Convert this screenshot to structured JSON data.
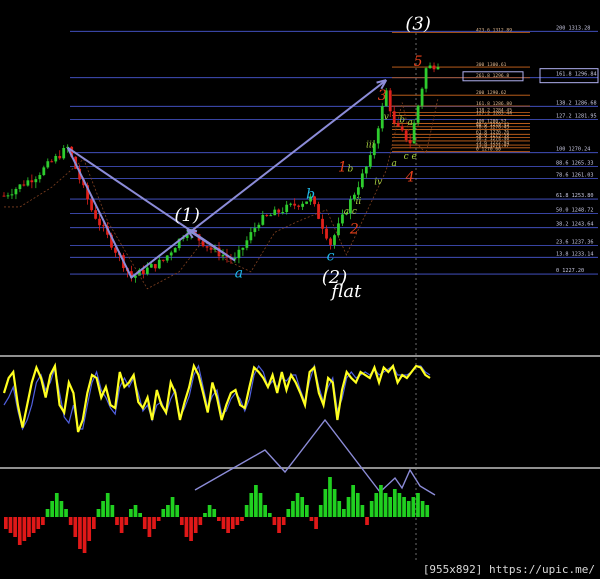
{
  "watermark": "[955x892] https://upic.me/",
  "colors": {
    "background": "#000000",
    "up_candle": "#2ecc2e",
    "down_candle": "#e0201a",
    "fib_line_blue": "#4a5ad8",
    "fib_line_orange": "#d2691e",
    "wave_arrow": "#8c8cd8",
    "wave_red": "#e8401a",
    "wave_cyan": "#20b8e8",
    "wave_white": "#ffffff",
    "wave_yellowgreen": "#a8d040",
    "oscillator_yellow": "#ffff20",
    "oscillator_blue": "#5060e0",
    "hist_green": "#20d020",
    "hist_red": "#e01818",
    "separator": "#909090"
  },
  "chart_data": {
    "type": "candlestick",
    "instrument": "",
    "ylim": [
      1218,
      1318
    ],
    "x_bars": 110,
    "fib_levels_blue": [
      {
        "label": "200 1313.28",
        "value": 1313.28
      },
      {
        "label": "161.8 1296.84",
        "value": 1296.84
      },
      {
        "label": "138.2 1286.68",
        "value": 1286.68
      },
      {
        "label": "127.2 1281.95",
        "value": 1281.95
      },
      {
        "label": "100 1270.24",
        "value": 1270.24
      },
      {
        "label": "88.6 1265.33",
        "value": 1265.33
      },
      {
        "label": "78.6 1261.03",
        "value": 1261.03
      },
      {
        "label": "61.8 1253.80",
        "value": 1253.8
      },
      {
        "label": "50.0 1248.72",
        "value": 1248.72
      },
      {
        "label": "38.2 1243.64",
        "value": 1243.64
      },
      {
        "label": "23.6 1237.36",
        "value": 1237.36
      },
      {
        "label": "13.8 1233.14",
        "value": 1233.14
      },
      {
        "label": "0 1227.20",
        "value": 1227.2
      }
    ],
    "fib_levels_orange": [
      {
        "label": "423.6 1312.89",
        "value": 1312.89
      },
      {
        "label": "300 1300.61",
        "value": 1300.61
      },
      {
        "label": "261.8 1296.8",
        "value": 1296.8
      },
      {
        "label": "200 1290.62",
        "value": 1290.62
      },
      {
        "label": "161.8 1286.80",
        "value": 1286.8
      },
      {
        "label": "138.2 1284.45",
        "value": 1284.45
      },
      {
        "label": "127.2 1283.44",
        "value": 1283.44
      },
      {
        "label": "100 1280.57",
        "value": 1280.57
      },
      {
        "label": "88.6 1279.43",
        "value": 1279.43
      },
      {
        "label": "78.6 1278.43",
        "value": 1278.43
      },
      {
        "label": "61.8 1276.76",
        "value": 1276.76
      },
      {
        "label": "50.0 1275.58",
        "value": 1275.58
      },
      {
        "label": "38.2 1274.40",
        "value": 1274.4
      },
      {
        "label": "23.6 1272.94",
        "value": 1272.94
      },
      {
        "label": "13.8 1271.97",
        "value": 1271.97
      },
      {
        "label": "0 1270.60",
        "value": 1270.6
      }
    ],
    "wave_labels": [
      {
        "text": "(3)",
        "color": "wave_white",
        "bar": 104,
        "price": 1314
      },
      {
        "text": "5",
        "color": "wave_red",
        "bar": 104,
        "price": 1301
      },
      {
        "text": "3",
        "color": "wave_red",
        "bar": 95,
        "price": 1289
      },
      {
        "text": "v",
        "color": "wave_yellowgreen",
        "bar": 96,
        "price": 1282
      },
      {
        "text": "b",
        "color": "wave_yellowgreen",
        "bar": 100,
        "price": 1281
      },
      {
        "text": "a",
        "color": "wave_yellowgreen",
        "bar": 102,
        "price": 1280
      },
      {
        "text": "iii",
        "color": "wave_yellowgreen",
        "bar": 92,
        "price": 1272
      },
      {
        "text": "c",
        "color": "wave_yellowgreen",
        "bar": 101,
        "price": 1268
      },
      {
        "text": "e",
        "color": "wave_yellowgreen",
        "bar": 103,
        "price": 1268
      },
      {
        "text": "a",
        "color": "wave_yellowgreen",
        "bar": 98,
        "price": 1265.5
      },
      {
        "text": "1",
        "color": "wave_red",
        "bar": 85,
        "price": 1263.5
      },
      {
        "text": "b",
        "color": "wave_yellowgreen",
        "bar": 87,
        "price": 1263.5
      },
      {
        "text": "4",
        "color": "wave_red",
        "bar": 102,
        "price": 1260
      },
      {
        "text": "iv",
        "color": "wave_yellowgreen",
        "bar": 94,
        "price": 1259
      },
      {
        "text": "ii",
        "color": "wave_yellowgreen",
        "bar": 89,
        "price": 1252
      },
      {
        "text": "a",
        "color": "wave_yellowgreen",
        "bar": 86,
        "price": 1248.5
      },
      {
        "text": "c",
        "color": "wave_yellowgreen",
        "bar": 88,
        "price": 1248.5
      },
      {
        "text": "b",
        "color": "wave_cyan",
        "bar": 77,
        "price": 1254
      },
      {
        "text": "(1)",
        "color": "wave_white",
        "bar": 46,
        "price": 1246
      },
      {
        "text": "2",
        "color": "wave_red",
        "bar": 88,
        "price": 1241.5
      },
      {
        "text": "c",
        "color": "wave_cyan",
        "bar": 82,
        "price": 1232
      },
      {
        "text": "a",
        "color": "wave_cyan",
        "bar": 59,
        "price": 1226
      },
      {
        "text": "(2)",
        "color": "wave_white",
        "bar": 83,
        "price": 1224
      },
      {
        "text": "flat",
        "color": "wave_white",
        "bar": 86,
        "price": 1219
      }
    ],
    "wave_path": [
      {
        "bar": 16,
        "price": 1272
      },
      {
        "bar": 32,
        "price": 1226
      },
      {
        "bar": 96,
        "price": 1296
      }
    ],
    "wave_path_2": [
      {
        "bar": 16,
        "price": 1272
      },
      {
        "bar": 58,
        "price": 1232
      },
      {
        "bar": 46,
        "price": 1243
      }
    ],
    "oscillator": {
      "type": "line",
      "series": [
        {
          "values": [
            48,
            58,
            62,
            40,
            25,
            40,
            55,
            65,
            58,
            45,
            60,
            66,
            40,
            35,
            55,
            48,
            22,
            30,
            48,
            60,
            58,
            45,
            52,
            40,
            38,
            62,
            52,
            55,
            60,
            42,
            38,
            45,
            30,
            50,
            40,
            35,
            55,
            48,
            30,
            42,
            52,
            66,
            60,
            48,
            35,
            55,
            45,
            30,
            40,
            48,
            50,
            40,
            38,
            52,
            65,
            62,
            58,
            52,
            60,
            48,
            62,
            50,
            60,
            55,
            48,
            40,
            62,
            65,
            48,
            40,
            58,
            55,
            30,
            50,
            62,
            58,
            55,
            62,
            60,
            58,
            65,
            55,
            65,
            62,
            66,
            55,
            60,
            58,
            62,
            66,
            65,
            60,
            58
          ]
        },
        {
          "values": [
            40,
            45,
            52,
            36,
            24,
            30,
            40,
            55,
            60,
            50,
            55,
            65,
            48,
            32,
            28,
            40,
            24,
            24,
            40,
            55,
            62,
            50,
            45,
            38,
            34,
            52,
            58,
            52,
            58,
            48,
            36,
            40,
            30,
            40,
            42,
            34,
            44,
            50,
            32,
            38,
            46,
            60,
            66,
            52,
            38,
            46,
            50,
            34,
            36,
            44,
            48,
            44,
            36,
            44,
            60,
            66,
            62,
            52,
            56,
            52,
            58,
            56,
            60,
            60,
            50,
            42,
            56,
            66,
            52,
            42,
            52,
            58,
            36,
            44,
            58,
            62,
            58,
            60,
            62,
            60,
            64,
            60,
            62,
            64,
            66,
            60,
            60,
            60,
            62,
            66,
            66,
            62,
            60
          ]
        }
      ]
    },
    "histogram": {
      "type": "bar",
      "values": [
        -6,
        -8,
        -10,
        -14,
        -12,
        -10,
        -8,
        -6,
        -4,
        4,
        8,
        12,
        8,
        4,
        -4,
        -10,
        -16,
        -18,
        -12,
        -6,
        4,
        8,
        12,
        6,
        -4,
        -8,
        -4,
        4,
        6,
        2,
        -6,
        -10,
        -6,
        -2,
        4,
        6,
        10,
        6,
        -4,
        -10,
        -12,
        -8,
        -4,
        2,
        6,
        4,
        -2,
        -6,
        -8,
        -6,
        -4,
        -2,
        6,
        12,
        16,
        12,
        6,
        2,
        -4,
        -8,
        -4,
        4,
        8,
        12,
        10,
        6,
        -2,
        -6,
        6,
        14,
        20,
        14,
        8,
        4,
        10,
        16,
        12,
        6,
        -4,
        8,
        12,
        16,
        12,
        10,
        14,
        12,
        10,
        8,
        10,
        12,
        8,
        6
      ]
    }
  }
}
